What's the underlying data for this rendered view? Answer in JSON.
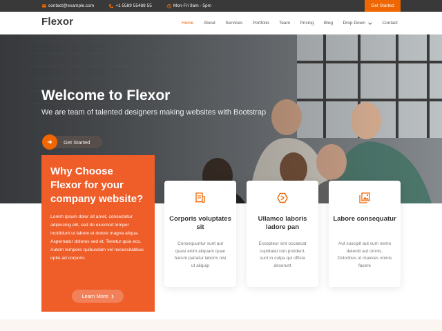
{
  "topbar": {
    "email": "contact@example.com",
    "phone": "+1 5589 55488 55",
    "hours": "Mon-Fri 9am - 5pm",
    "cta_label": "Get Started"
  },
  "header": {
    "logo": "Flexor",
    "nav": [
      "Home",
      "About",
      "Services",
      "Portfolio",
      "Team",
      "Pricing",
      "Blog",
      "Drop Down",
      "Contact"
    ]
  },
  "hero": {
    "title": "Welcome to Flexor",
    "subtitle": "We are team of talented designers making websites with Bootstrap",
    "button_label": "Get Started"
  },
  "why": {
    "title": "Why Choose Flexor for your company website?",
    "text": "Lorem ipsum dolor sit amet, consectetur adipiscing elit, sed do eiusmod tempor incididunt ut labore et dolore magna aliqua. Aspernatur dolores sed et. Tenetur quia eos. Autem tempore quibusdam vel necessitatibus optio ad corporis.",
    "button_label": "Learn More"
  },
  "cards": [
    {
      "title": "Corporis voluptates sit",
      "text": "Consequuntur sunt aut quasi enim aliquam quae harum pariatur laboris nisi ut aliquip",
      "icon": "receipt-icon"
    },
    {
      "title": "Ullamco laboris ladore pan",
      "text": "Excepteur sint occaecat cupidatat non proident, sunt in culpa qui officia deserunt",
      "icon": "cube-icon"
    },
    {
      "title": "Labore consequatur",
      "text": "Aut suscipit aut cum nemo deleniti aut omnis. Doloribus ut maiores omnis facere",
      "icon": "images-icon"
    }
  ],
  "colors": {
    "accent": "#ef6603",
    "why_bg": "#ef5d29",
    "topbar_bg": "#3a3939"
  }
}
